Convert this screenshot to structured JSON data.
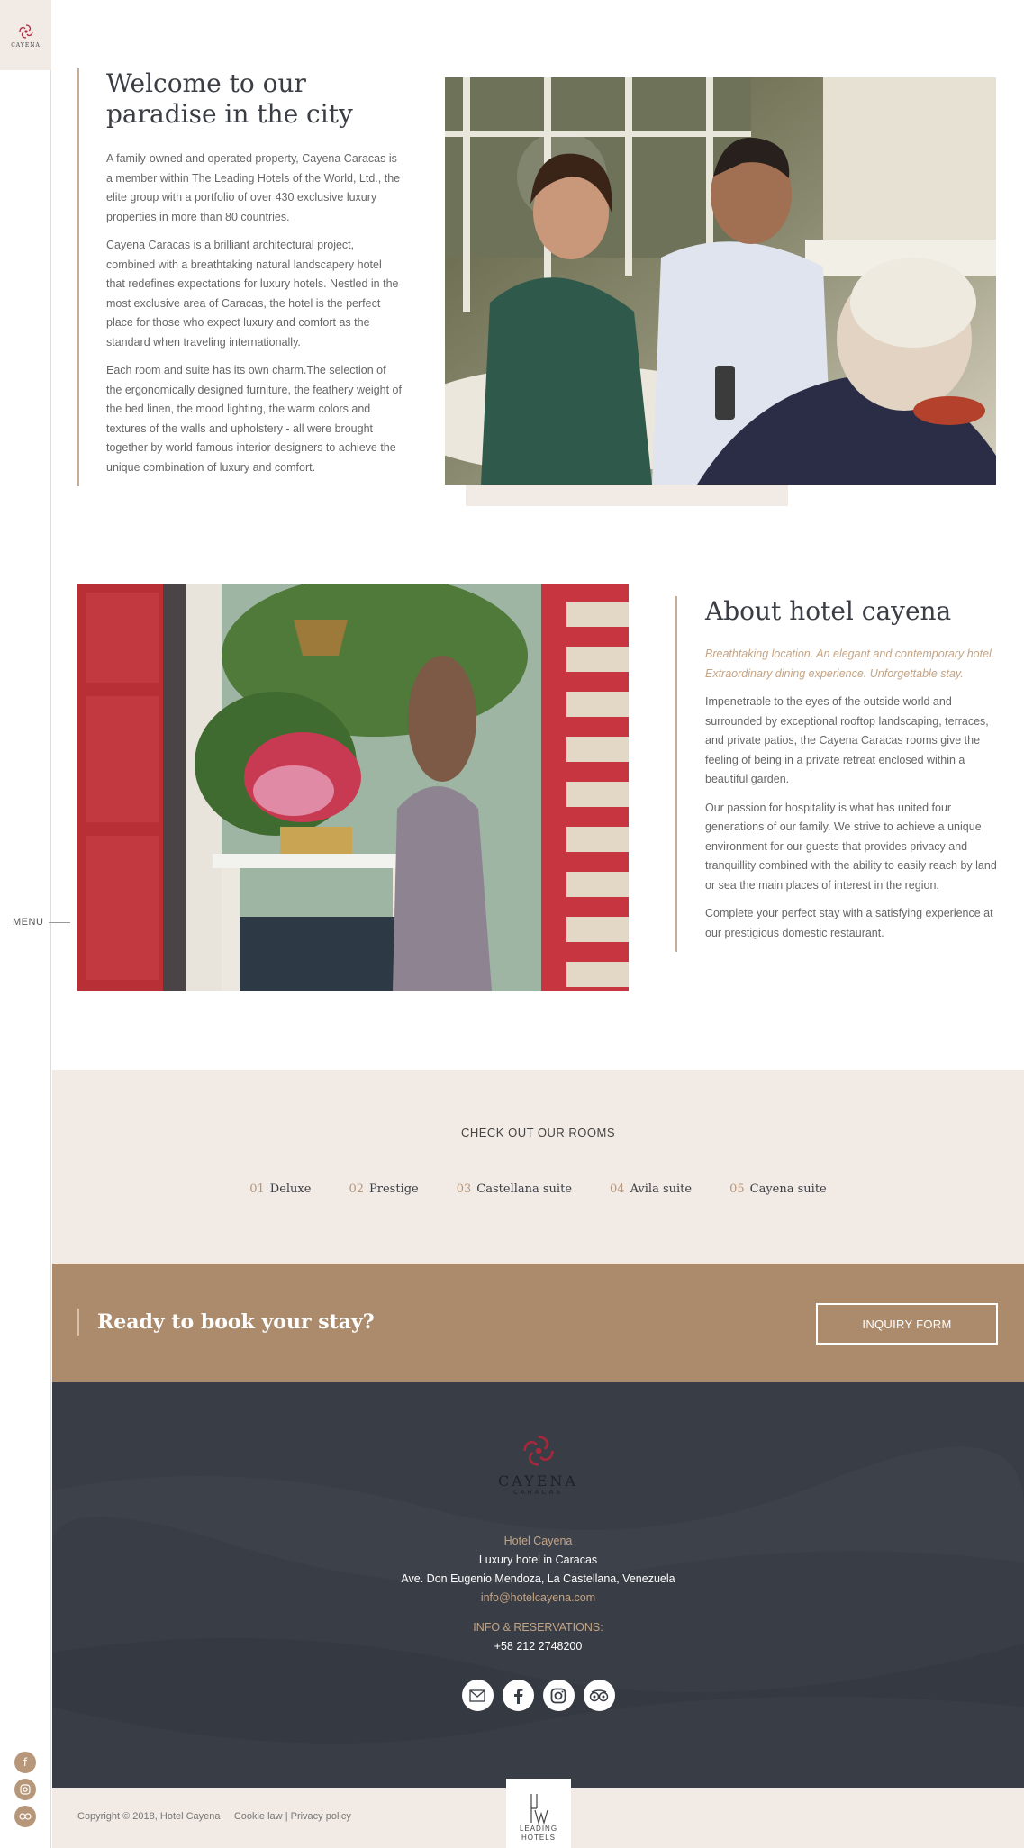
{
  "brand": {
    "side_logo_text": "CAYENA",
    "accent": "#ab8b6c",
    "dark": "#393d45",
    "cream": "#f2ebe5"
  },
  "sidebar": {
    "menu_label": "MENU",
    "social_icons": [
      "facebook-icon",
      "instagram-icon",
      "tripadvisor-icon"
    ]
  },
  "welcome": {
    "title": "Welcome to our paradise in the city",
    "paragraphs": [
      "A family-owned and operated property, Cayena Caracas is a member within The Leading Hotels of the World, Ltd., the elite group with a portfolio of over 430 exclusive luxury properties in more than 80 countries.",
      "Cayena Caracas is a brilliant architectural project, combined with a breathtaking natural landscapery hotel that redefines expectations for luxury hotels. Nestled in the most exclusive area of Caracas, the hotel is the perfect place for those who expect luxury and comfort as the standard when traveling internationally.",
      "Each room and suite has its own charm.The selection of the ergonomically designed furniture, the feathery weight of the bed linen, the mood lighting, the warm colors and textures of the walls and upholstery - all were brought together by world-famous interior designers to achieve the unique combination of luxury and comfort."
    ]
  },
  "about": {
    "title": "About hotel cayena",
    "lead": "Breathtaking location. An elegant and contemporary hotel. Extraordinary dining experience. Unforgettable stay.",
    "paragraphs": [
      "Impenetrable to the eyes of the outside world and surrounded by exceptional rooftop landscaping, terraces, and private patios, the Cayena Caracas rooms give the feeling of being in a private retreat enclosed within a beautiful garden.",
      "Our passion for hospitality is what has united four generations of our family. We strive to achieve a unique environment for our guests that provides privacy and tranquillity combined with the ability to easily reach by land or sea the main places of interest in the region.",
      "Complete your perfect stay with a satisfying experience at our prestigious domestic restaurant."
    ]
  },
  "rooms": {
    "heading": "CHECK OUT OUR ROOMS",
    "items": [
      {
        "num": "01",
        "label": "Deluxe"
      },
      {
        "num": "02",
        "label": "Prestige"
      },
      {
        "num": "03",
        "label": "Castellana suite"
      },
      {
        "num": "04",
        "label": "Avila suite"
      },
      {
        "num": "05",
        "label": "Cayena suite"
      }
    ]
  },
  "cta": {
    "title": "Ready to book your stay?",
    "button_label": "INQUIRY FORM"
  },
  "footer": {
    "logo_name": "CAYENA",
    "logo_sub": "CARACAS",
    "hotel_name": "Hotel Cayena",
    "tagline": "Luxury hotel in Caracas",
    "address": "Ave. Don Eugenio Mendoza, La Castellana, Venezuela",
    "email": "info@hotelcayena.com",
    "reservations_label": "INFO & RESERVATIONS:",
    "phone": "+58 212 2748200",
    "social_icons": [
      "mail-icon",
      "facebook-icon",
      "instagram-icon",
      "tripadvisor-icon"
    ]
  },
  "bottom": {
    "copyright": "Copyright © 2018, Hotel Cayena",
    "cookie_law": "Cookie law",
    "separator": "|",
    "privacy_policy": "Privacy policy",
    "lhw_line1": "LEADING",
    "lhw_line2": "HOTELS"
  }
}
